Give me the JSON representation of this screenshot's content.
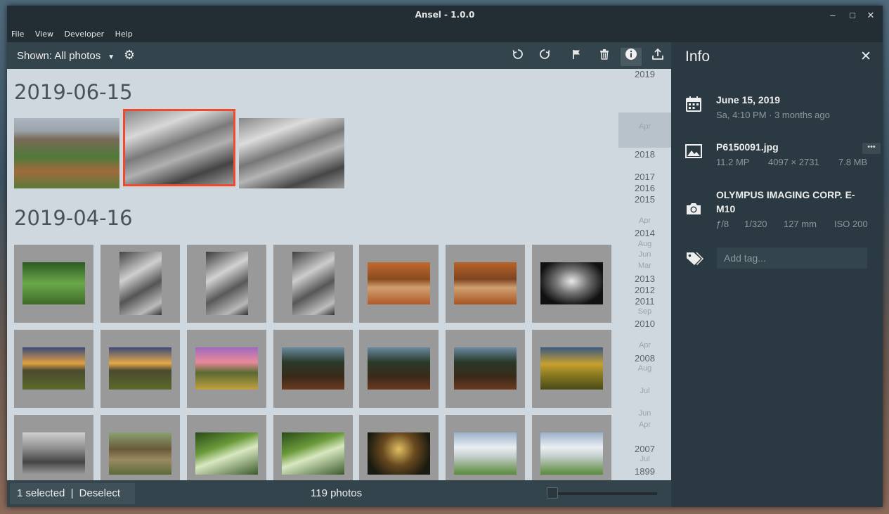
{
  "window": {
    "title": "Ansel - 1.0.0"
  },
  "menu": [
    "File",
    "View",
    "Developer",
    "Help"
  ],
  "toolbar": {
    "shown_label": "Shown: All photos",
    "icons": [
      "rotate-left-icon",
      "rotate-right-icon",
      "flag-icon",
      "trash-icon",
      "info-icon",
      "share-icon"
    ]
  },
  "groups": [
    {
      "date": "2019-06-15"
    },
    {
      "date": "2019-04-16"
    }
  ],
  "timeline": [
    {
      "label": "2019",
      "kind": "year"
    },
    {
      "label": "Apr",
      "kind": "month"
    },
    {
      "label": "2018",
      "kind": "year"
    },
    {
      "label": "2017",
      "kind": "year"
    },
    {
      "label": "2016",
      "kind": "year"
    },
    {
      "label": "2015",
      "kind": "year"
    },
    {
      "label": "Apr",
      "kind": "month"
    },
    {
      "label": "2014",
      "kind": "year"
    },
    {
      "label": "Aug",
      "kind": "month"
    },
    {
      "label": "Jun",
      "kind": "month"
    },
    {
      "label": "Mar",
      "kind": "month"
    },
    {
      "label": "2013",
      "kind": "year"
    },
    {
      "label": "2012",
      "kind": "year"
    },
    {
      "label": "2011",
      "kind": "year"
    },
    {
      "label": "Sep",
      "kind": "month"
    },
    {
      "label": "2010",
      "kind": "year"
    },
    {
      "label": "Apr",
      "kind": "month"
    },
    {
      "label": "2008",
      "kind": "year"
    },
    {
      "label": "Aug",
      "kind": "month"
    },
    {
      "label": "Jul",
      "kind": "month"
    },
    {
      "label": "Jun",
      "kind": "month"
    },
    {
      "label": "Apr",
      "kind": "month"
    },
    {
      "label": "2007",
      "kind": "year"
    },
    {
      "label": "Jul",
      "kind": "month"
    },
    {
      "label": "1899",
      "kind": "year"
    }
  ],
  "status": {
    "selected": "1 selected",
    "separator": "|",
    "deselect": "Deselect",
    "count": "119 photos"
  },
  "info": {
    "title": "Info",
    "date": "June 15, 2019",
    "date_sub": "Sa, 4:10 PM · 3 months ago",
    "filename": "P6150091.jpg",
    "megapixels": "11.2 MP",
    "dimensions": "4097 × 2731",
    "filesize": "7.8 MB",
    "camera": "OLYMPUS IMAGING CORP. E-M10",
    "aperture": "ƒ/8",
    "shutter": "1/320",
    "focal": "127 mm",
    "iso": "ISO 200",
    "more": "•••",
    "tag_placeholder": "Add tag..."
  }
}
